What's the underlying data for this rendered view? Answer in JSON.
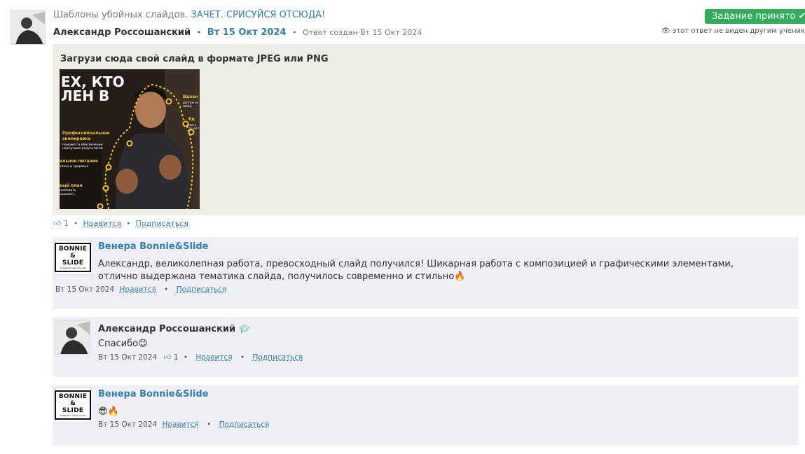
{
  "header": {
    "title_prefix": "Шаблоны убойных слайдов.",
    "title_link": "ЗАЧЕТ. СРИСУЙСЯ ОТСЮДА!",
    "author": "Александр Россошанский",
    "date": "Вт 15 Окт 2024",
    "created": "Ответ создан Вт 15 Окт 2024",
    "status_button": "Задание принято",
    "status_icon": "check-icon",
    "visibility_notice": "этот ответ не виден другим ученикам",
    "visibility_icon": "eye-slash-icon"
  },
  "answer": {
    "prompt": "Загрузи сюда свой слайд в формате JPEG или PNG",
    "slide_text": {
      "headline_1": "ЕХ, КТО",
      "headline_2": "ЛЕН В",
      "label_1": "Вдохн",
      "label_1_sub": "достиж со звезд",
      "label_2": "Ед",
      "label_2_sub": "нап с тр част",
      "label_3": "Профессиональная экипировка",
      "label_3_sub": "поможет в обеспечении наилучших результатов",
      "label_4": "альное питание",
      "label_4_sub": "спеха и здоровья",
      "label_5": "ный план",
      "label_5_sub": "нижевать оваивать"
    },
    "likes": "1",
    "like_label": "Нравится",
    "subscribe_label": "Подписаться"
  },
  "comments": [
    {
      "author": "Венера Bonnie&Slide",
      "text": "Александр, великолепная работа, превосходный слайд получился! Шикарная работа с композицией и графическими элементами, отлично выдержана тематика слайда, получилось современно и стильно🔥",
      "date": "Вт 15 Окт 2024",
      "like_label": "Нравится",
      "subscribe_label": "Подписаться",
      "logo_line1": "BONNIE",
      "logo_line2": "& SLIDE",
      "logo_sub": "академия презентаций"
    },
    {
      "author": "Александр Россошанский",
      "badge_icon": "graduation-cap-icon",
      "text": "Спасибо😊",
      "date": "Вт 15 Окт 2024",
      "likes": "1",
      "like_label": "Нравится",
      "subscribe_label": "Подписаться"
    },
    {
      "author": "Венера Bonnie&Slide",
      "text": "😎🔥",
      "date": "Вт 15 Окт 2024",
      "like_label": "Нравится",
      "subscribe_label": "Подписаться",
      "logo_line1": "BONNIE",
      "logo_line2": "& SLIDE",
      "logo_sub": "академия презентаций"
    }
  ],
  "colors": {
    "accent": "#2e80b5",
    "success": "#2fad5b",
    "answer_bg": "#efeee6",
    "comment_bg": "#eeeff4",
    "slide_yellow": "#f5c518"
  }
}
